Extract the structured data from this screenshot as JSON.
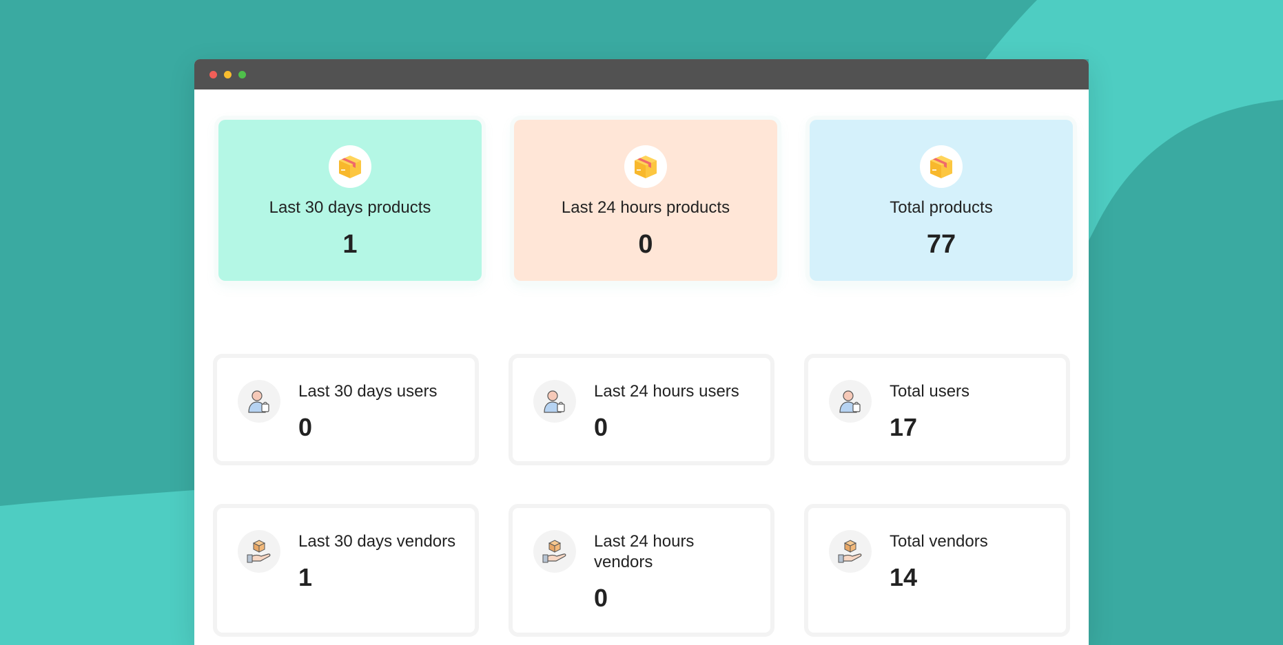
{
  "colors": {
    "background_teal": "#3aaaa1",
    "background_light_teal": "#4ecdc2",
    "titlebar": "#525252",
    "card_mint": "#b4f7e5",
    "card_peach": "#ffe6d7",
    "card_sky": "#d5f1fb"
  },
  "product_cards": [
    {
      "label": "Last 30 days products",
      "value": "1",
      "icon": "package-box-icon"
    },
    {
      "label": "Last 24 hours products",
      "value": "0",
      "icon": "package-box-icon"
    },
    {
      "label": "Total products",
      "value": "77",
      "icon": "package-box-icon"
    }
  ],
  "user_cards": [
    {
      "label": "Last 30 days users",
      "value": "0",
      "icon": "shopper-user-icon"
    },
    {
      "label": "Last 24 hours users",
      "value": "0",
      "icon": "shopper-user-icon"
    },
    {
      "label": "Total users",
      "value": "17",
      "icon": "shopper-user-icon"
    }
  ],
  "vendor_cards": [
    {
      "label": "Last 30 days vendors",
      "value": "1",
      "icon": "hand-box-vendor-icon"
    },
    {
      "label": "Last 24 hours vendors",
      "value": "0",
      "icon": "hand-box-vendor-icon"
    },
    {
      "label": "Total vendors",
      "value": "14",
      "icon": "hand-box-vendor-icon"
    }
  ]
}
